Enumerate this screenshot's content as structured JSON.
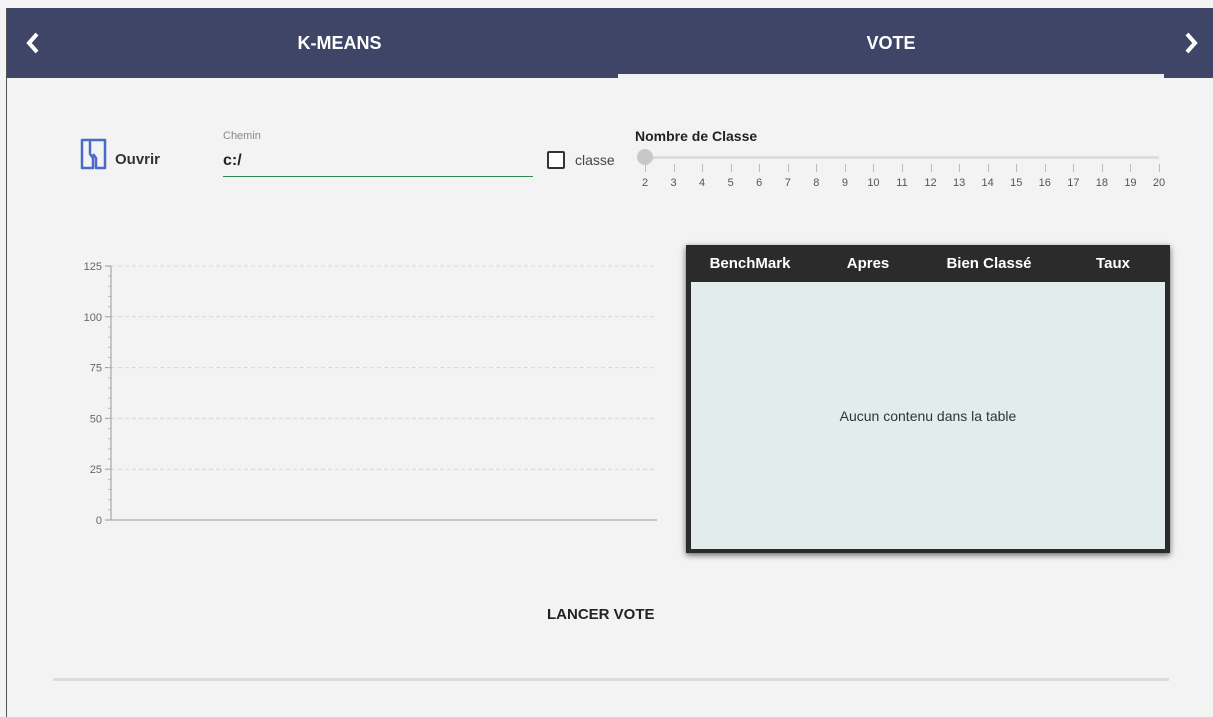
{
  "tabs": [
    {
      "label": "K-MEANS",
      "active": false
    },
    {
      "label": "VOTE",
      "active": true
    }
  ],
  "nav": {
    "prev_icon": "chevron-left-icon",
    "next_icon": "chevron-right-icon"
  },
  "open": {
    "label": "Ouvrir",
    "icon": "open-folder-icon"
  },
  "path": {
    "label": "Chemin",
    "value": "c:/"
  },
  "checkbox": {
    "label": "classe",
    "checked": false
  },
  "slider": {
    "title": "Nombre de Classe",
    "min": 2,
    "max": 20,
    "value": 2,
    "ticks": [
      "2",
      "3",
      "4",
      "5",
      "6",
      "7",
      "8",
      "9",
      "10",
      "11",
      "12",
      "13",
      "14",
      "15",
      "16",
      "17",
      "18",
      "19",
      "20"
    ]
  },
  "chart_data": {
    "type": "line",
    "series": [],
    "yticks": [
      "125",
      "100",
      "75",
      "50",
      "25",
      "0"
    ],
    "ylim": [
      0,
      125
    ],
    "grid": true
  },
  "table": {
    "columns": [
      "BenchMark",
      "Apres",
      "Bien Classé",
      "Taux"
    ],
    "rows": [],
    "empty_text": "Aucun contenu dans la table"
  },
  "actions": {
    "launch_label": "LANCER VOTE"
  },
  "colors": {
    "header_bg": "#3e4566",
    "accent": "#2f8a4f",
    "icon": "#4a6bc9",
    "table_bg": "#e2eced"
  }
}
